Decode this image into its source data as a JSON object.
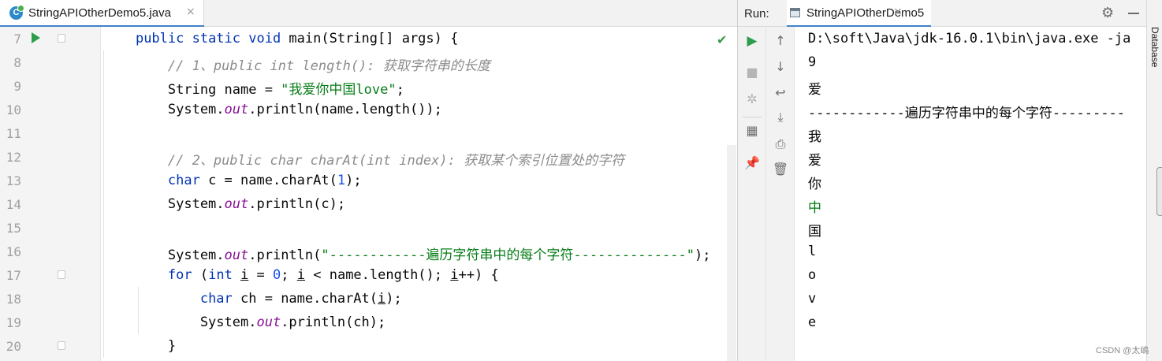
{
  "editor": {
    "tab": {
      "filename": "StringAPIOtherDemo5.java",
      "icon": "java-class-icon",
      "close": "×"
    },
    "lines": [
      {
        "num": "7",
        "segments": [
          {
            "t": "    "
          },
          {
            "t": "public static void",
            "c": "kw"
          },
          {
            "t": " main(String[] args) {"
          }
        ]
      },
      {
        "num": "8",
        "segments": [
          {
            "t": "        "
          },
          {
            "t": "// 1、public int length(): 获取字符串的长度",
            "c": "cmt"
          }
        ]
      },
      {
        "num": "9",
        "segments": [
          {
            "t": "        String name = "
          },
          {
            "t": "\"我爱你中国love\"",
            "c": "str"
          },
          {
            "t": ";"
          }
        ]
      },
      {
        "num": "10",
        "segments": [
          {
            "t": "        System."
          },
          {
            "t": "out",
            "c": "fld"
          },
          {
            "t": ".println(name.length());"
          }
        ]
      },
      {
        "num": "11",
        "segments": []
      },
      {
        "num": "12",
        "segments": [
          {
            "t": "        "
          },
          {
            "t": "// 2、public char charAt(int index): 获取某个索引位置处的字符",
            "c": "cmt"
          }
        ]
      },
      {
        "num": "13",
        "segments": [
          {
            "t": "        "
          },
          {
            "t": "char",
            "c": "kw"
          },
          {
            "t": " c = name.charAt("
          },
          {
            "t": "1",
            "c": "num"
          },
          {
            "t": ");"
          }
        ]
      },
      {
        "num": "14",
        "segments": [
          {
            "t": "        System."
          },
          {
            "t": "out",
            "c": "fld"
          },
          {
            "t": ".println(c);"
          }
        ]
      },
      {
        "num": "15",
        "segments": []
      },
      {
        "num": "16",
        "segments": [
          {
            "t": "        System."
          },
          {
            "t": "out",
            "c": "fld"
          },
          {
            "t": ".println("
          },
          {
            "t": "\"------------遍历字符串中的每个字符--------------\"",
            "c": "str"
          },
          {
            "t": ");"
          }
        ]
      },
      {
        "num": "17",
        "segments": [
          {
            "t": "        "
          },
          {
            "t": "for",
            "c": "kw"
          },
          {
            "t": " ("
          },
          {
            "t": "int",
            "c": "kw"
          },
          {
            "t": " "
          },
          {
            "t": "i",
            "c": "uvar"
          },
          {
            "t": " = "
          },
          {
            "t": "0",
            "c": "num"
          },
          {
            "t": "; "
          },
          {
            "t": "i",
            "c": "uvar"
          },
          {
            "t": " < name.length(); "
          },
          {
            "t": "i",
            "c": "uvar"
          },
          {
            "t": "++) {"
          }
        ]
      },
      {
        "num": "18",
        "segments": [
          {
            "t": "            "
          },
          {
            "t": "char",
            "c": "kw"
          },
          {
            "t": " ch = name.charAt("
          },
          {
            "t": "i",
            "c": "uvar"
          },
          {
            "t": ");"
          }
        ]
      },
      {
        "num": "19",
        "segments": [
          {
            "t": "            System."
          },
          {
            "t": "out",
            "c": "fld"
          },
          {
            "t": ".println(ch);"
          }
        ]
      },
      {
        "num": "20",
        "segments": [
          {
            "t": "        }"
          }
        ]
      }
    ]
  },
  "run": {
    "label": "Run:",
    "tab_name": "StringAPIOtherDemo5",
    "tab_close": "×",
    "settings_icon": "gear-icon",
    "toolbar1": [
      "rerun-icon",
      "stop-icon",
      "debug-icon",
      "layout-icon",
      "pin-icon"
    ],
    "toolbar2": [
      "scroll-up-icon",
      "scroll-down-icon",
      "soft-wrap-icon",
      "scroll-to-end-icon",
      "print-icon",
      "trash-icon"
    ],
    "console_lines": [
      "D:\\soft\\Java\\jdk-16.0.1\\bin\\java.exe -ja",
      "9",
      "爱",
      "------------遍历字符串中的每个字符---------",
      "我",
      "爱",
      "你",
      "中",
      "国",
      "l",
      "o",
      "v",
      "e"
    ]
  },
  "side_panel": {
    "database_label": "Database"
  },
  "watermark": "CSDN @太嶋"
}
